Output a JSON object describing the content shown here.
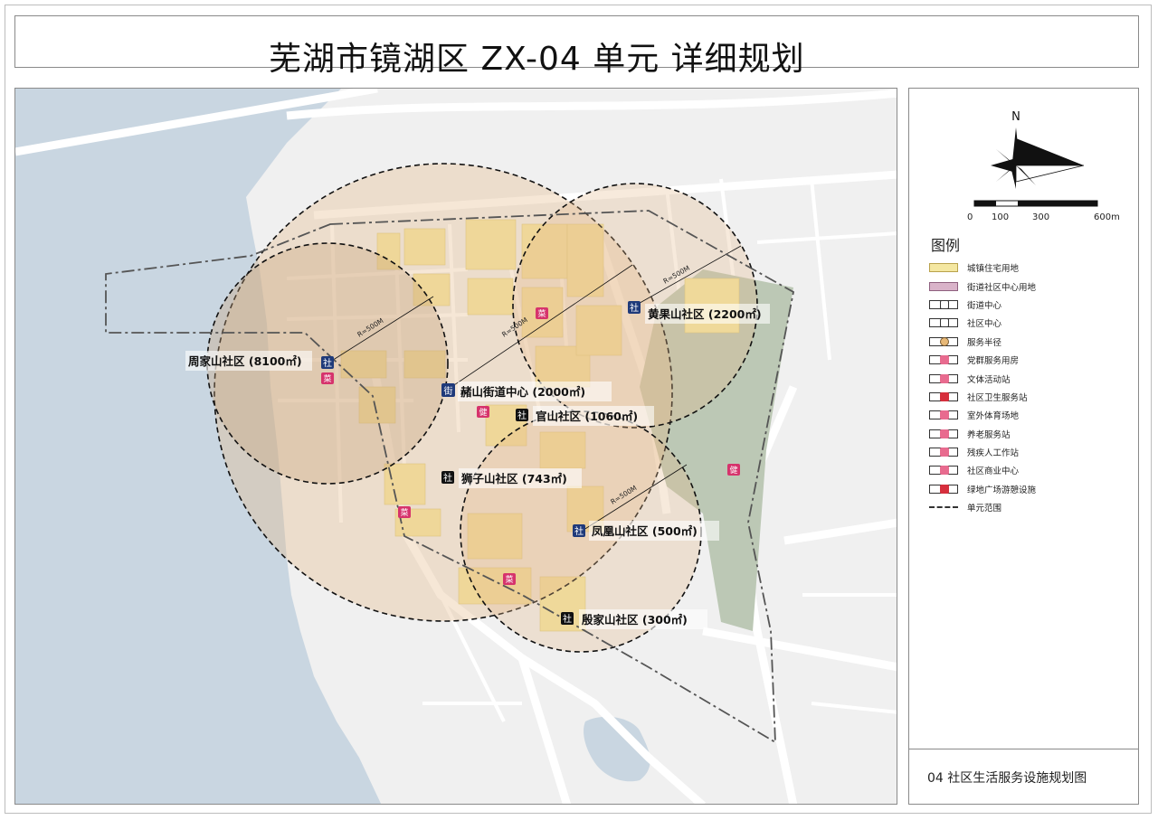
{
  "title": "芜湖市镜湖区 ZX-04 单元 详细规划",
  "compass": {
    "north_label": "N",
    "icon": "north-arrow-icon"
  },
  "scale_bar": {
    "ticks": [
      "0",
      "100",
      "300",
      "600m"
    ]
  },
  "legend": {
    "title": "图例",
    "items": [
      {
        "label": "城镇住宅用地",
        "icon": "residential-land-swatch",
        "color": "#f4e7a1"
      },
      {
        "label": "街道社区中心用地",
        "icon": "community-center-land-swatch",
        "color": "#d9b3c9"
      },
      {
        "label": "街道中心",
        "icon": "street-center-icon"
      },
      {
        "label": "社区中心",
        "icon": "community-center-icon"
      },
      {
        "label": "服务半径",
        "icon": "service-radius-icon",
        "color": "#e8b978"
      },
      {
        "label": "党群服务用房",
        "icon": "party-service-icon"
      },
      {
        "label": "文体活动站",
        "icon": "culture-sports-icon"
      },
      {
        "label": "社区卫生服务站",
        "icon": "health-station-icon"
      },
      {
        "label": "室外体育场地",
        "icon": "outdoor-sports-icon"
      },
      {
        "label": "养老服务站",
        "icon": "elderly-care-icon"
      },
      {
        "label": "残疾人工作站",
        "icon": "disabled-station-icon"
      },
      {
        "label": "社区商业中心",
        "icon": "commercial-center-icon"
      },
      {
        "label": "绿地广场游憩设施",
        "icon": "green-plaza-icon"
      },
      {
        "label": "单元范围",
        "icon": "unit-boundary-icon"
      }
    ]
  },
  "sheet_title": "04 社区生活服务设施规划图",
  "map": {
    "radius_label": "R=500M",
    "markers": {
      "community": "社",
      "street": "街",
      "vegetable": "菜",
      "fitness": "健"
    },
    "communities": [
      {
        "name": "周家山社区 (8100㎡)"
      },
      {
        "name": "赭山街道中心 (2000㎡)"
      },
      {
        "name": "黄果山社区 (2200㎡)"
      },
      {
        "name": "官山社区 (1060㎡)"
      },
      {
        "name": "狮子山社区 (743㎡)"
      },
      {
        "name": "凤凰山社区 (500㎡)"
      },
      {
        "name": "殷家山社区 (300㎡)"
      }
    ]
  },
  "colors": {
    "water": "#c9d6e1",
    "residential": "#f4e7a1",
    "service_radius": "#e8c9a3",
    "green": "#bcc8b5",
    "marker_blue": "#1f3a7a",
    "marker_black": "#111111",
    "marker_pink": "#d6336c"
  }
}
